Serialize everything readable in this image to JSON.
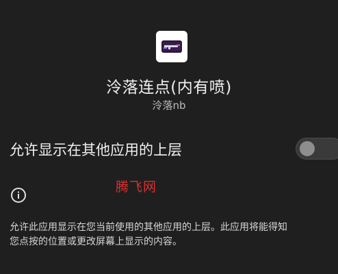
{
  "app": {
    "name": "泠落连点(内有喷)",
    "package": "泠落nb",
    "icon": "app-logo-icon"
  },
  "permission": {
    "label": "允许显示在其他应用的上层",
    "toggle_state": "off"
  },
  "watermark": {
    "text": "腾飞网"
  },
  "info": {
    "icon": "info-icon",
    "description": "允许此应用显示在您当前使用的其他应用的上层。此应用将能得知\n您点按的位置或更改屏幕上显示的内容。"
  },
  "colors": {
    "background": "#1f1f1f",
    "watermark": "#d93030",
    "toggle_track": "#3a3a3a",
    "toggle_knob": "#8e8e8e"
  }
}
